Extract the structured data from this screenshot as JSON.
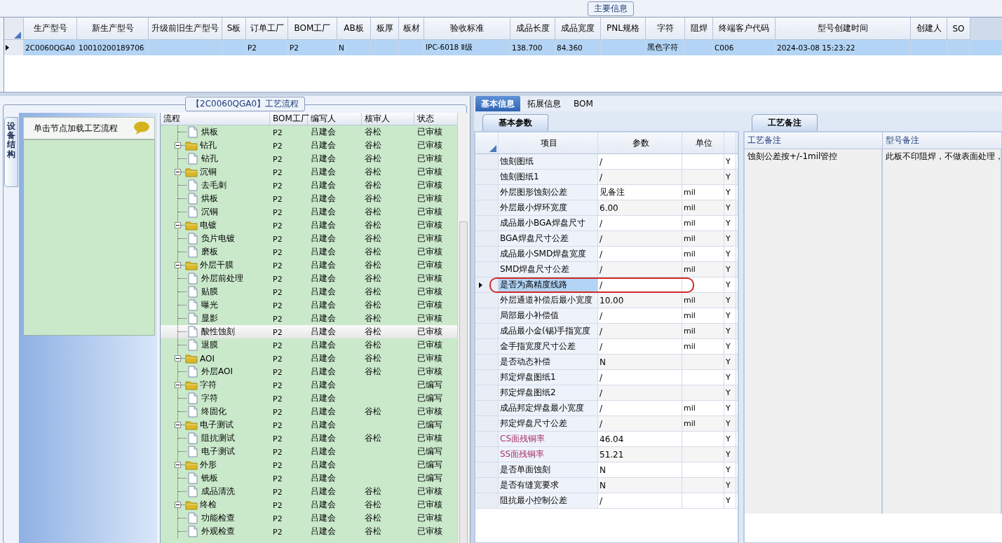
{
  "main_info": {
    "title": "主要信息",
    "row_selected": true,
    "columns": [
      {
        "label": "生产型号",
        "value": "2C0060QGA0"
      },
      {
        "label": "新生产型号",
        "value": "10010200189706"
      },
      {
        "label": "升级前旧生产型号"
      },
      {
        "label": "S板"
      },
      {
        "label": "订单工厂",
        "value": "P2"
      },
      {
        "label": "BOM工厂",
        "value": "P2"
      },
      {
        "label": "AB板",
        "value": "N"
      },
      {
        "label": "板厚"
      },
      {
        "label": "板材"
      },
      {
        "label": "验收标准",
        "value": "IPC-6018 Ⅱ级"
      },
      {
        "label": "成品长度",
        "value": "138.700"
      },
      {
        "label": "成品宽度",
        "value": "84.360"
      },
      {
        "label": "PNL规格"
      },
      {
        "label": "字符",
        "value": "黑色字符"
      },
      {
        "label": "阻焊"
      },
      {
        "label": "终端客户代码",
        "value": "C006"
      },
      {
        "label": "型号创建时间",
        "value": "2024-03-08 15:23:22"
      },
      {
        "label": "创建人"
      },
      {
        "label": "SO"
      }
    ]
  },
  "process": {
    "title": "【2C0060QGA0】工艺流程",
    "side_tab": "设备结构",
    "hint": "单击节点加载工艺流程",
    "columns": [
      "流程",
      "BOM工厂",
      "编写人",
      "核审人",
      "状态"
    ],
    "nodes": [
      {
        "kind": "file",
        "name": "烘板",
        "factory": "P2",
        "author": "吕建会",
        "reviewer": "谷松",
        "status": "已审核",
        "selected": false
      },
      {
        "kind": "folder",
        "name": "钻孔",
        "factory": "P2",
        "author": "吕建会",
        "reviewer": "谷松",
        "status": "已审核",
        "selected": false,
        "expanded": true,
        "children": [
          {
            "kind": "file",
            "name": "钻孔",
            "factory": "P2",
            "author": "吕建会",
            "reviewer": "谷松",
            "status": "已审核",
            "selected": false
          }
        ]
      },
      {
        "kind": "folder",
        "name": "沉铜",
        "factory": "P2",
        "author": "吕建会",
        "reviewer": "谷松",
        "status": "已审核",
        "selected": false,
        "expanded": true,
        "children": [
          {
            "kind": "file",
            "name": "去毛刺",
            "factory": "P2",
            "author": "吕建会",
            "reviewer": "谷松",
            "status": "已审核",
            "selected": false
          },
          {
            "kind": "file",
            "name": "烘板",
            "factory": "P2",
            "author": "吕建会",
            "reviewer": "谷松",
            "status": "已审核",
            "selected": false
          },
          {
            "kind": "file",
            "name": "沉铜",
            "factory": "P2",
            "author": "吕建会",
            "reviewer": "谷松",
            "status": "已审核",
            "selected": false
          }
        ]
      },
      {
        "kind": "folder",
        "name": "电镀",
        "factory": "P2",
        "author": "吕建会",
        "reviewer": "谷松",
        "status": "已审核",
        "selected": false,
        "expanded": true,
        "children": [
          {
            "kind": "file",
            "name": "负片电镀",
            "factory": "P2",
            "author": "吕建会",
            "reviewer": "谷松",
            "status": "已审核",
            "selected": false
          },
          {
            "kind": "file",
            "name": "磨板",
            "factory": "P2",
            "author": "吕建会",
            "reviewer": "谷松",
            "status": "已审核",
            "selected": false
          }
        ]
      },
      {
        "kind": "folder",
        "name": "外层干膜",
        "factory": "P2",
        "author": "吕建会",
        "reviewer": "谷松",
        "status": "已审核",
        "selected": false,
        "expanded": true,
        "children": [
          {
            "kind": "file",
            "name": "外层前处理",
            "factory": "P2",
            "author": "吕建会",
            "reviewer": "谷松",
            "status": "已审核",
            "selected": false
          },
          {
            "kind": "file",
            "name": "贴膜",
            "factory": "P2",
            "author": "吕建会",
            "reviewer": "谷松",
            "status": "已审核",
            "selected": false
          },
          {
            "kind": "file",
            "name": "曝光",
            "factory": "P2",
            "author": "吕建会",
            "reviewer": "谷松",
            "status": "已审核",
            "selected": false
          },
          {
            "kind": "file",
            "name": "显影",
            "factory": "P2",
            "author": "吕建会",
            "reviewer": "谷松",
            "status": "已审核",
            "selected": false
          },
          {
            "kind": "file",
            "name": "酸性蚀刻",
            "factory": "P2",
            "author": "吕建会",
            "reviewer": "谷松",
            "status": "已审核",
            "selected": true
          },
          {
            "kind": "file",
            "name": "退膜",
            "factory": "P2",
            "author": "吕建会",
            "reviewer": "谷松",
            "status": "已审核",
            "selected": false
          }
        ]
      },
      {
        "kind": "folder",
        "name": "AOI",
        "factory": "P2",
        "author": "吕建会",
        "reviewer": "谷松",
        "status": "已审核",
        "selected": false,
        "expanded": true,
        "children": [
          {
            "kind": "file",
            "name": "外层AOI",
            "factory": "P2",
            "author": "吕建会",
            "reviewer": "谷松",
            "status": "已审核",
            "selected": false
          }
        ]
      },
      {
        "kind": "folder",
        "name": "字符",
        "factory": "P2",
        "author": "吕建会",
        "status": "已编写",
        "selected": false,
        "expanded": true,
        "children": [
          {
            "kind": "file",
            "name": "字符",
            "factory": "P2",
            "author": "吕建会",
            "status": "已编写",
            "selected": false
          },
          {
            "kind": "file",
            "name": "终固化",
            "factory": "P2",
            "author": "吕建会",
            "reviewer": "谷松",
            "status": "已审核",
            "selected": false
          }
        ]
      },
      {
        "kind": "folder",
        "name": "电子测试",
        "factory": "P2",
        "author": "吕建会",
        "status": "已编写",
        "selected": false,
        "expanded": true,
        "children": [
          {
            "kind": "file",
            "name": "阻抗测试",
            "factory": "P2",
            "author": "吕建会",
            "reviewer": "谷松",
            "status": "已审核",
            "selected": false
          },
          {
            "kind": "file",
            "name": "电子测试",
            "factory": "P2",
            "author": "吕建会",
            "status": "已编写",
            "selected": false
          }
        ]
      },
      {
        "kind": "folder",
        "name": "外形",
        "factory": "P2",
        "author": "吕建会",
        "status": "已编写",
        "selected": false,
        "expanded": true,
        "children": [
          {
            "kind": "file",
            "name": "铣板",
            "factory": "P2",
            "author": "吕建会",
            "status": "已编写",
            "selected": false
          },
          {
            "kind": "file",
            "name": "成品清洗",
            "factory": "P2",
            "author": "吕建会",
            "reviewer": "谷松",
            "status": "已审核",
            "selected": false
          }
        ]
      },
      {
        "kind": "folder",
        "name": "终检",
        "factory": "P2",
        "author": "吕建会",
        "reviewer": "谷松",
        "status": "已审核",
        "selected": false,
        "expanded": true,
        "children": [
          {
            "kind": "file",
            "name": "功能检查",
            "factory": "P2",
            "author": "吕建会",
            "reviewer": "谷松",
            "status": "已审核",
            "selected": false
          },
          {
            "kind": "file",
            "name": "外观检查",
            "factory": "P2",
            "author": "吕建会",
            "reviewer": "谷松",
            "status": "已审核",
            "selected": false
          }
        ]
      }
    ]
  },
  "detail": {
    "tabs": [
      {
        "label": "基本信息",
        "selected": true
      },
      {
        "label": "拓展信息",
        "selected": false
      },
      {
        "label": "BOM",
        "selected": false
      }
    ],
    "params": {
      "tab": "基本参数",
      "columns": [
        "项目",
        "参数",
        "单位"
      ],
      "rows": [
        {
          "name": "蚀刻图纸",
          "value": "/",
          "flag": "Y",
          "selected": false
        },
        {
          "name": "蚀刻图纸1",
          "value": "/",
          "flag": "Y",
          "selected": false
        },
        {
          "name": "外层图形蚀刻公差",
          "value": "见备注",
          "unit": "mil",
          "flag": "Y",
          "selected": false
        },
        {
          "name": "外层最小焊环宽度",
          "value": "6.00",
          "unit": "mil",
          "flag": "Y",
          "selected": false
        },
        {
          "name": "成品最小BGA焊盘尺寸",
          "value": "/",
          "unit": "mil",
          "flag": "Y",
          "selected": false
        },
        {
          "name": "BGA焊盘尺寸公差",
          "value": "/",
          "unit": "mil",
          "flag": "Y",
          "selected": false
        },
        {
          "name": "成品最小SMD焊盘宽度",
          "value": "/",
          "unit": "mil",
          "flag": "Y",
          "selected": false
        },
        {
          "name": "SMD焊盘尺寸公差",
          "value": "/",
          "unit": "mil",
          "flag": "Y",
          "selected": false
        },
        {
          "name": "是否为高精度线路",
          "value": "/",
          "flag": "Y",
          "selected": true
        },
        {
          "name": "外层通道补偿后最小宽度",
          "value": "10.00",
          "unit": "mil",
          "flag": "Y",
          "selected": false
        },
        {
          "name": "局部最小补偿值",
          "value": "/",
          "unit": "mil",
          "flag": "Y",
          "selected": false
        },
        {
          "name": "成品最小金(锡)手指宽度",
          "value": "/",
          "unit": "mil",
          "flag": "Y",
          "selected": false
        },
        {
          "name": "金手指宽度尺寸公差",
          "value": "/",
          "unit": "mil",
          "flag": "Y",
          "selected": false
        },
        {
          "name": "是否动态补偿",
          "value": "N",
          "flag": "Y",
          "selected": false
        },
        {
          "name": "邦定焊盘图纸1",
          "value": "/",
          "flag": "Y",
          "selected": false
        },
        {
          "name": "邦定焊盘图纸2",
          "value": "/",
          "flag": "Y",
          "selected": false
        },
        {
          "name": "成品邦定焊盘最小宽度",
          "value": "/",
          "unit": "mil",
          "flag": "Y",
          "selected": false
        },
        {
          "name": "邦定焊盘尺寸公差",
          "value": "/",
          "unit": "mil",
          "flag": "Y",
          "selected": false
        },
        {
          "name": "CS面残铜率",
          "value": "46.04",
          "flag": "Y",
          "selected": false,
          "color": "#a8306a"
        },
        {
          "name": "SS面残铜率",
          "value": "51.21",
          "flag": "Y",
          "selected": false,
          "color": "#a8306a"
        },
        {
          "name": "是否单面蚀刻",
          "value": "N",
          "flag": "Y",
          "selected": false
        },
        {
          "name": "是否有缝宽要求",
          "value": "N",
          "flag": "Y",
          "selected": false
        },
        {
          "name": "阻抗最小控制公差",
          "value": "/",
          "flag": "Y",
          "selected": false
        }
      ]
    },
    "notes": {
      "tab": "工艺备注",
      "columns": [
        "工艺备注",
        "型号备注"
      ],
      "values": [
        "蚀刻公差按+/-1mil管控",
        "此板不印阻焊，不做表面处理，"
      ]
    }
  }
}
